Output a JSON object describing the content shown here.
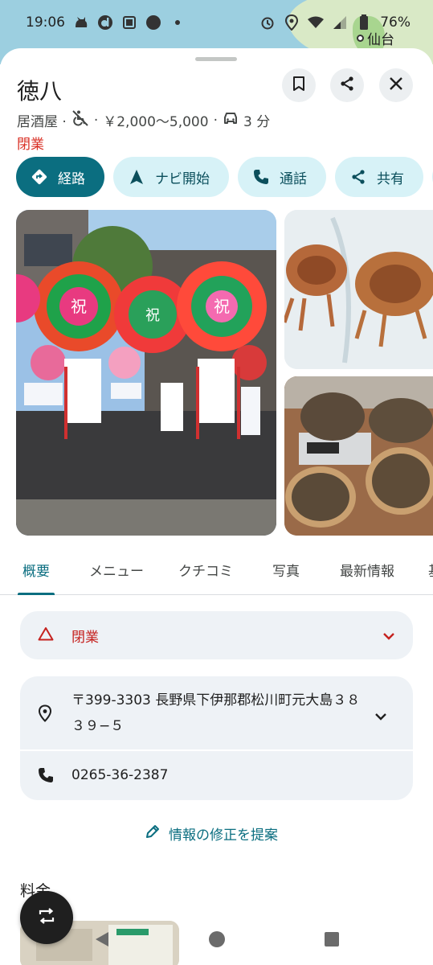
{
  "status_bar": {
    "time": "19:06",
    "battery": "76%",
    "map_label": "仙台"
  },
  "place": {
    "name": "徳八",
    "category": "居酒屋 ·",
    "separator": "·",
    "price": "￥2,000～5,000",
    "drive_time": "3 分",
    "status": "閉業"
  },
  "actions": [
    {
      "label": "経路"
    },
    {
      "label": "ナビ開始"
    },
    {
      "label": "通話"
    },
    {
      "label": "共有"
    }
  ],
  "tabs": [
    {
      "label": "概要"
    },
    {
      "label": "メニュー"
    },
    {
      "label": "クチコミ"
    },
    {
      "label": "写真"
    },
    {
      "label": "最新情報"
    },
    {
      "label": "基"
    }
  ],
  "closed_card": {
    "label": "閉業"
  },
  "address": "〒399-3303 長野県下伊那郡松川町元大島３８３９−５",
  "phone": "0265-36-2387",
  "suggest_edit": "情報の修正を提案",
  "section_title": "料金",
  "photo_sign_char": "祝",
  "colors": {
    "accent": "#0b6e80",
    "chip_bg": "#d7f2f7",
    "closed_red": "#d93025",
    "card_bg": "#eef2f6"
  }
}
